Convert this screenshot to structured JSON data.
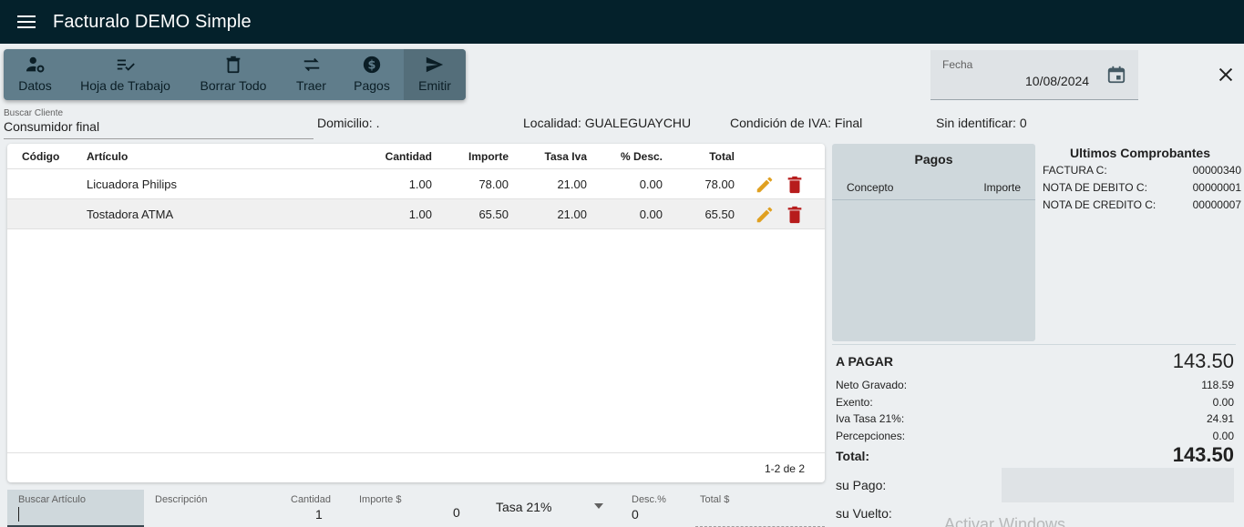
{
  "app": {
    "title": "Facturalo DEMO Simple"
  },
  "toolbar": [
    {
      "label": "Datos",
      "icon": "user-gear-icon"
    },
    {
      "label": "Hoja de Trabajo",
      "icon": "checklist-icon"
    },
    {
      "label": "Borrar Todo",
      "icon": "trash-icon"
    },
    {
      "label": "Traer",
      "icon": "swap-icon"
    },
    {
      "label": "Pagos",
      "icon": "dollar-icon"
    },
    {
      "label": "Emitir",
      "icon": "send-icon"
    }
  ],
  "fecha": {
    "label": "Fecha",
    "value": "10/08/2024"
  },
  "cliente": {
    "label": "Buscar Cliente",
    "value": "Consumidor final"
  },
  "info": {
    "domicilio": "Domicilio: .",
    "localidad": "Localidad: GUALEGUAYCHU",
    "condicion_iva": "Condición de IVA: Final",
    "sin_identificar": "Sin identificar: 0"
  },
  "table": {
    "headers": {
      "codigo": "Código",
      "articulo": "Artículo",
      "cantidad": "Cantidad",
      "importe": "Importe",
      "tasa_iva": "Tasa Iva",
      "desc": "% Desc.",
      "total": "Total"
    },
    "rows": [
      {
        "codigo": "",
        "articulo": "Licuadora Philips",
        "cantidad": "1.00",
        "importe": "78.00",
        "tasa_iva": "21.00",
        "desc": "0.00",
        "total": "78.00"
      },
      {
        "codigo": "",
        "articulo": "Tostadora ATMA",
        "cantidad": "1.00",
        "importe": "65.50",
        "tasa_iva": "21.00",
        "desc": "0.00",
        "total": "65.50"
      }
    ],
    "pagination": "1-2 de 2"
  },
  "pagos": {
    "title": "Pagos",
    "concepto": "Concepto",
    "importe": "Importe"
  },
  "ultimos": {
    "title": "Ultimos Comprobantes",
    "items": [
      {
        "label": "FACTURA C:",
        "value": "00000340"
      },
      {
        "label": "NOTA DE DEBITO C:",
        "value": "00000001"
      },
      {
        "label": "NOTA DE CREDITO C:",
        "value": "00000007"
      }
    ]
  },
  "totales": {
    "a_pagar_label": "A PAGAR",
    "a_pagar_value": "143.50",
    "neto_label": "Neto Gravado:",
    "neto_value": "118.59",
    "exento_label": "Exento:",
    "exento_value": "0.00",
    "iva_label": "Iva Tasa 21%:",
    "iva_value": "24.91",
    "percepciones_label": "Percepciones:",
    "percepciones_value": "0.00",
    "total_label": "Total:",
    "total_value": "143.50",
    "su_pago_label": "su Pago:",
    "su_vuelto_label": "su Vuelto:"
  },
  "entry": {
    "buscar_articulo": "Buscar Artículo",
    "descripcion": "Descripción",
    "cantidad_label": "Cantidad",
    "cantidad_value": "1",
    "importe_label": "Importe $",
    "importe_value": "0",
    "tasa_value": "Tasa 21%",
    "desc_label": "Desc.%",
    "desc_value": "0",
    "total_label": "Total $"
  },
  "watermark": "Activar Windows",
  "colors": {
    "appbar": "#04212b",
    "toolbar": "#607d8b",
    "edit": "#e0a020",
    "delete": "#b71c1c"
  }
}
